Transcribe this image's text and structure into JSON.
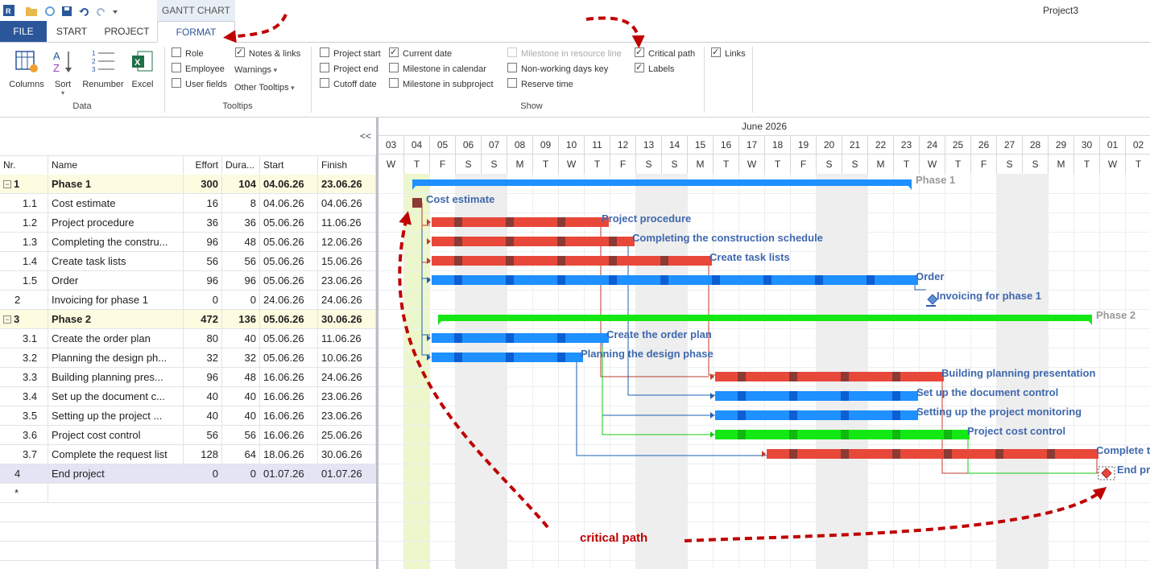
{
  "app": {
    "project_name": "Project3",
    "context_tab": "GANTT CHART"
  },
  "tabs": {
    "file": "FILE",
    "start": "START",
    "project": "PROJECT",
    "format": "FORMAT"
  },
  "ribbon": {
    "data": {
      "title": "Data",
      "columns": "Columns",
      "sort": "Sort",
      "renumber": "Renumber",
      "excel": "Excel"
    },
    "tooltips": {
      "title": "Tooltips",
      "role": {
        "label": "Role",
        "checked": false
      },
      "employee": {
        "label": "Employee",
        "checked": false
      },
      "user_fields": {
        "label": "User fields",
        "checked": false
      },
      "notes_links": {
        "label": "Notes & links",
        "checked": true
      },
      "warnings": "Warnings",
      "other_tooltips": "Other Tooltips"
    },
    "show": {
      "title": "Show",
      "project_start": {
        "label": "Project start",
        "checked": false
      },
      "project_end": {
        "label": "Project end",
        "checked": false
      },
      "cutoff_date": {
        "label": "Cutoff date",
        "checked": false
      },
      "current_date": {
        "label": "Current date",
        "checked": true
      },
      "milestone_calendar": {
        "label": "Milestone in calendar",
        "checked": false
      },
      "milestone_subproject": {
        "label": "Milestone in subproject",
        "checked": false
      },
      "milestone_resource": {
        "label": "Milestone in resource line",
        "checked": false
      },
      "nonworking_key": {
        "label": "Non-working days key",
        "checked": false
      },
      "reserve_time": {
        "label": "Reserve time",
        "checked": false
      },
      "critical_path": {
        "label": "Critical path",
        "checked": true
      },
      "labels": {
        "label": "Labels",
        "checked": true
      },
      "links": {
        "label": "Links",
        "checked": true
      }
    }
  },
  "grid": {
    "collapse_label": "<<",
    "headers": {
      "nr": "Nr.",
      "name": "Name",
      "effort": "Effort",
      "duration": "Dura...",
      "start": "Start",
      "finish": "Finish"
    },
    "new_row_marker": "*",
    "rows": [
      {
        "nr": "1",
        "name": "Phase 1",
        "effort": "300",
        "duration": "104",
        "start": "04.06.26",
        "finish": "23.06.26",
        "summary": true
      },
      {
        "nr": "1.1",
        "name": "Cost estimate",
        "effort": "16",
        "duration": "8",
        "start": "04.06.26",
        "finish": "04.06.26"
      },
      {
        "nr": "1.2",
        "name": "Project procedure",
        "effort": "36",
        "duration": "36",
        "start": "05.06.26",
        "finish": "11.06.26"
      },
      {
        "nr": "1.3",
        "name": "Completing the constru...",
        "effort": "96",
        "duration": "48",
        "start": "05.06.26",
        "finish": "12.06.26"
      },
      {
        "nr": "1.4",
        "name": "Create task lists",
        "effort": "56",
        "duration": "56",
        "start": "05.06.26",
        "finish": "15.06.26"
      },
      {
        "nr": "1.5",
        "name": "Order",
        "effort": "96",
        "duration": "96",
        "start": "05.06.26",
        "finish": "23.06.26"
      },
      {
        "nr": "2",
        "name": "Invoicing for phase 1",
        "effort": "0",
        "duration": "0",
        "start": "24.06.26",
        "finish": "24.06.26"
      },
      {
        "nr": "3",
        "name": "Phase 2",
        "effort": "472",
        "duration": "136",
        "start": "05.06.26",
        "finish": "30.06.26",
        "summary": true
      },
      {
        "nr": "3.1",
        "name": "Create the order plan",
        "effort": "80",
        "duration": "40",
        "start": "05.06.26",
        "finish": "11.06.26"
      },
      {
        "nr": "3.2",
        "name": "Planning the design ph...",
        "effort": "32",
        "duration": "32",
        "start": "05.06.26",
        "finish": "10.06.26"
      },
      {
        "nr": "3.3",
        "name": "Building planning pres...",
        "effort": "96",
        "duration": "48",
        "start": "16.06.26",
        "finish": "24.06.26"
      },
      {
        "nr": "3.4",
        "name": "Set up the document c...",
        "effort": "40",
        "duration": "40",
        "start": "16.06.26",
        "finish": "23.06.26"
      },
      {
        "nr": "3.5",
        "name": "Setting up the project ...",
        "effort": "40",
        "duration": "40",
        "start": "16.06.26",
        "finish": "23.06.26"
      },
      {
        "nr": "3.6",
        "name": "Project cost control",
        "effort": "56",
        "duration": "56",
        "start": "16.06.26",
        "finish": "25.06.26"
      },
      {
        "nr": "3.7",
        "name": "Complete the request list",
        "effort": "128",
        "duration": "64",
        "start": "18.06.26",
        "finish": "30.06.26"
      },
      {
        "nr": "4",
        "name": "End project",
        "effort": "0",
        "duration": "0",
        "start": "01.07.26",
        "finish": "01.07.26",
        "selected": true
      }
    ]
  },
  "timeline": {
    "month": "June 2026",
    "days": [
      {
        "d": "03",
        "w": "W"
      },
      {
        "d": "04",
        "w": "T"
      },
      {
        "d": "05",
        "w": "F"
      },
      {
        "d": "06",
        "w": "S"
      },
      {
        "d": "07",
        "w": "S"
      },
      {
        "d": "08",
        "w": "M"
      },
      {
        "d": "09",
        "w": "T"
      },
      {
        "d": "10",
        "w": "W"
      },
      {
        "d": "11",
        "w": "T"
      },
      {
        "d": "12",
        "w": "F"
      },
      {
        "d": "13",
        "w": "S"
      },
      {
        "d": "14",
        "w": "S"
      },
      {
        "d": "15",
        "w": "M"
      },
      {
        "d": "16",
        "w": "T"
      },
      {
        "d": "17",
        "w": "W"
      },
      {
        "d": "18",
        "w": "T"
      },
      {
        "d": "19",
        "w": "F"
      },
      {
        "d": "20",
        "w": "S"
      },
      {
        "d": "21",
        "w": "S"
      },
      {
        "d": "22",
        "w": "M"
      },
      {
        "d": "23",
        "w": "T"
      },
      {
        "d": "24",
        "w": "W"
      },
      {
        "d": "25",
        "w": "T"
      },
      {
        "d": "26",
        "w": "F"
      },
      {
        "d": "27",
        "w": "S"
      },
      {
        "d": "28",
        "w": "S"
      },
      {
        "d": "29",
        "w": "M"
      },
      {
        "d": "30",
        "w": "T"
      },
      {
        "d": "01",
        "w": "W"
      },
      {
        "d": "02",
        "w": "T"
      }
    ],
    "current_date": "04"
  },
  "bar_labels": {
    "phase1": "Phase 1",
    "cost_estimate": "Cost estimate",
    "project_procedure": "Project procedure",
    "construction_schedule": "Completing the construction schedule",
    "task_lists": "Create task lists",
    "order": "Order",
    "invoicing": "Invoicing for phase 1",
    "phase2": "Phase 2",
    "order_plan": "Create the order plan",
    "design_phase": "Planning the design phase",
    "building_presentation": "Building planning presentation",
    "document_control": "Set up the document control",
    "project_monitoring": "Setting up the project monitoring",
    "cost_control": "Project cost control",
    "request_list": "Complete t",
    "end_project": "End pr"
  },
  "annotation": {
    "critical_path": "critical path"
  },
  "colors": {
    "critical": "#e8483a",
    "normal": "#1e90ff",
    "green": "#14e814",
    "summary_blue": "#1e90ff",
    "annotation": "#c00000"
  }
}
